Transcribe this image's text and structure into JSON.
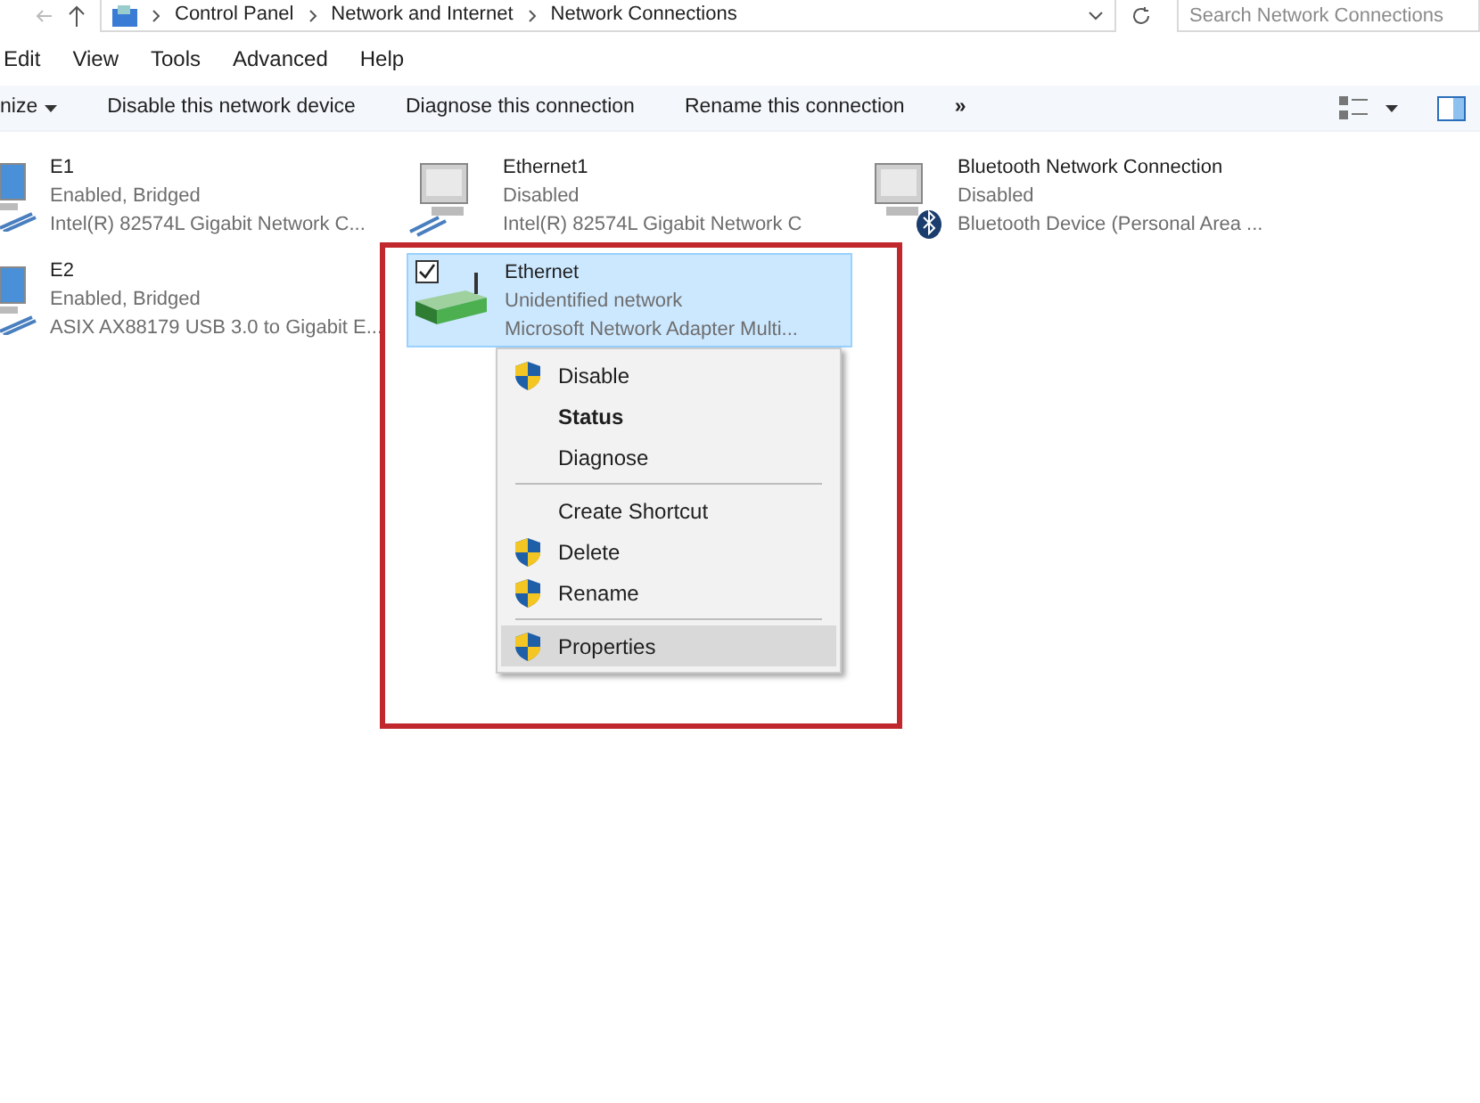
{
  "address_bar": {
    "breadcrumbs": [
      "Control Panel",
      "Network and Internet",
      "Network Connections"
    ],
    "search": {
      "placeholder": "Search Network Connections"
    }
  },
  "menu_bar": [
    "Edit",
    "View",
    "Tools",
    "Advanced",
    "Help"
  ],
  "toolbar": {
    "buttons": [
      "nize",
      "Disable this network device",
      "Diagnose this connection",
      "Rename this connection"
    ],
    "overflow": "»"
  },
  "connections": [
    {
      "name": "E1",
      "status": "Enabled, Bridged",
      "device": "Intel(R) 82574L Gigabit Network C...",
      "kind": "ethernet",
      "selected": false
    },
    {
      "name": "Ethernet1",
      "status": "Disabled",
      "device": "Intel(R) 82574L Gigabit Network C",
      "kind": "ethernet-disabled",
      "selected": false
    },
    {
      "name": "Bluetooth Network Connection",
      "status": "Disabled",
      "device": "Bluetooth Device (Personal Area ...",
      "kind": "bluetooth",
      "selected": false
    },
    {
      "name": "E2",
      "status": "Enabled, Bridged",
      "device": "ASIX AX88179 USB 3.0 to Gigabit E...",
      "kind": "ethernet",
      "selected": false
    },
    {
      "name": "Ethernet",
      "status": "Unidentified network",
      "device": "Microsoft Network Adapter Multi...",
      "kind": "adapter",
      "selected": true,
      "checked": true
    }
  ],
  "context_menu": [
    {
      "kind": "item",
      "label": "Disable",
      "shield": true,
      "bold": false,
      "selected": false
    },
    {
      "kind": "item",
      "label": "Status",
      "shield": false,
      "bold": true,
      "selected": false
    },
    {
      "kind": "item",
      "label": "Diagnose",
      "shield": false,
      "bold": false,
      "selected": false
    },
    {
      "kind": "separator"
    },
    {
      "kind": "item",
      "label": "Create Shortcut",
      "shield": false,
      "bold": false,
      "selected": false
    },
    {
      "kind": "item",
      "label": "Delete",
      "shield": true,
      "bold": false,
      "selected": false
    },
    {
      "kind": "item",
      "label": "Rename",
      "shield": true,
      "bold": false,
      "selected": false
    },
    {
      "kind": "separator"
    },
    {
      "kind": "item",
      "label": "Properties",
      "shield": true,
      "bold": false,
      "selected": true
    }
  ]
}
